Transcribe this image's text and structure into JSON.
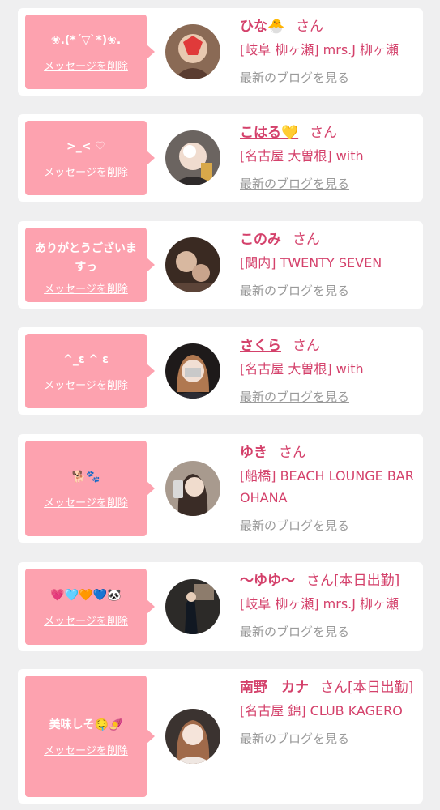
{
  "cards": [
    {
      "message": "❀.(*´▽`*)❀.",
      "delete_label": "メッセージを削除",
      "name": "ひな🐣",
      "honorific": "さん",
      "shop": "[岐阜 柳ヶ瀬] mrs.J 柳ヶ瀬",
      "blog_label": "最新のブログを見る"
    },
    {
      "message": ">_< ♡",
      "delete_label": "メッセージを削除",
      "name": "こはる💛",
      "honorific": "さん",
      "shop": "[名古屋 大曽根] with",
      "blog_label": "最新のブログを見る"
    },
    {
      "message": "ありがとうございますっ",
      "delete_label": "メッセージを削除",
      "name": "このみ",
      "honorific": "さん",
      "shop": "[関内] TWENTY SEVEN",
      "blog_label": "最新のブログを見る"
    },
    {
      "message": "^_ε ^ ε",
      "delete_label": "メッセージを削除",
      "name": "さくら",
      "honorific": "さん",
      "shop": "[名古屋 大曽根] with",
      "blog_label": "最新のブログを見る"
    },
    {
      "message": "🐕🐾",
      "delete_label": "メッセージを削除",
      "name": "ゆき",
      "honorific": "さん",
      "shop": "[船橋] BEACH LOUNGE BAR OHANA",
      "blog_label": "最新のブログを見る"
    },
    {
      "message": "💗🩵🧡💙🐼",
      "delete_label": "メッセージを削除",
      "name": "〜ゆゆ〜",
      "honorific": "さん[本日出勤]",
      "shop": "[岐阜 柳ヶ瀬] mrs.J 柳ヶ瀬",
      "blog_label": "最新のブログを見る"
    },
    {
      "message": "美味しそ🤤🍠",
      "delete_label": "メッセージを削除",
      "name": "南野　カナ",
      "honorific": "さん[本日出勤]",
      "shop": "[名古屋 錦] CLUB KAGERO",
      "blog_label": "最新のブログを見る"
    }
  ],
  "colors": {
    "bubble": "#fda2af",
    "accent": "#d4416b",
    "link_gray": "#9a9a9a",
    "background": "#efeff0"
  }
}
